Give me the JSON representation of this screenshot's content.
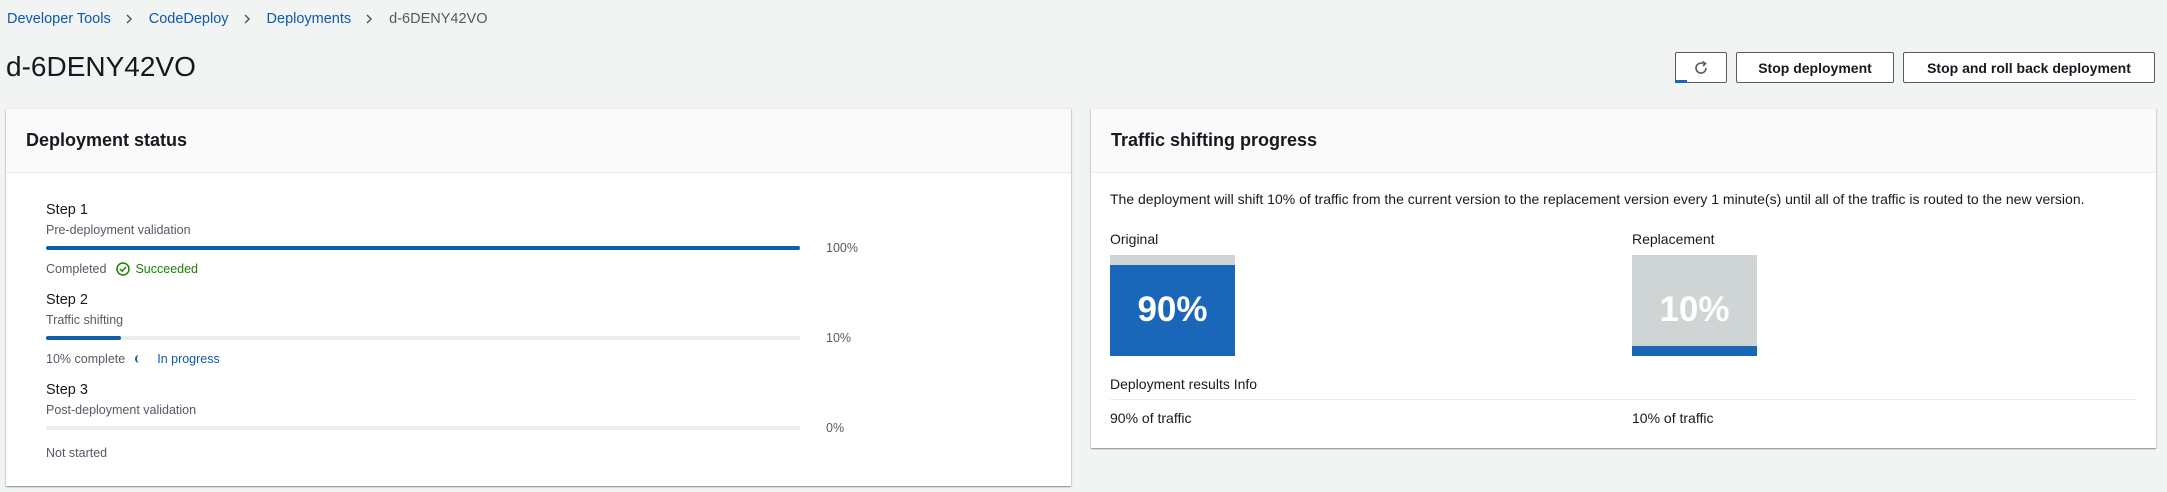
{
  "breadcrumbs": [
    {
      "label": "Developer Tools"
    },
    {
      "label": "CodeDeploy"
    },
    {
      "label": "Deployments"
    },
    {
      "label": "d-6DENY42VO"
    }
  ],
  "page_title": "d-6DENY42VO",
  "actions": {
    "refresh_icon": "refresh-icon",
    "stop_label": "Stop deployment",
    "rollback_label": "Stop and roll back deployment"
  },
  "deployment_status": {
    "header": "Deployment status",
    "steps": [
      {
        "title": "Step 1",
        "description": "Pre-deployment validation",
        "progress": 100,
        "percent_label": "100%",
        "status_prefix": "Completed",
        "status": "Succeeded"
      },
      {
        "title": "Step 2",
        "description": "Traffic shifting",
        "progress": 10,
        "percent_label": "10%",
        "status_prefix": "10% complete",
        "status": "In progress"
      },
      {
        "title": "Step 3",
        "description": "Post-deployment validation",
        "progress": 0,
        "percent_label": "0%",
        "status_prefix": "Not started",
        "status": ""
      }
    ]
  },
  "traffic": {
    "header": "Traffic shifting progress",
    "description": "The deployment will shift 10% of traffic from the current version to the replacement version every 1 minute(s) until all of the traffic is routed to the new version.",
    "original": {
      "label": "Original",
      "percent": 90,
      "percent_label": "90%",
      "result": "90% of traffic"
    },
    "replacement": {
      "label": "Replacement",
      "percent": 10,
      "percent_label": "10%",
      "result": "10% of traffic"
    },
    "results_title": "Deployment results Info"
  },
  "colors": {
    "accent": "#0a5ab0",
    "bar": "#0f5fa8",
    "success": "#1d8102",
    "box_bg": "#cfd5d5",
    "box_fill": "#1a66b9"
  }
}
